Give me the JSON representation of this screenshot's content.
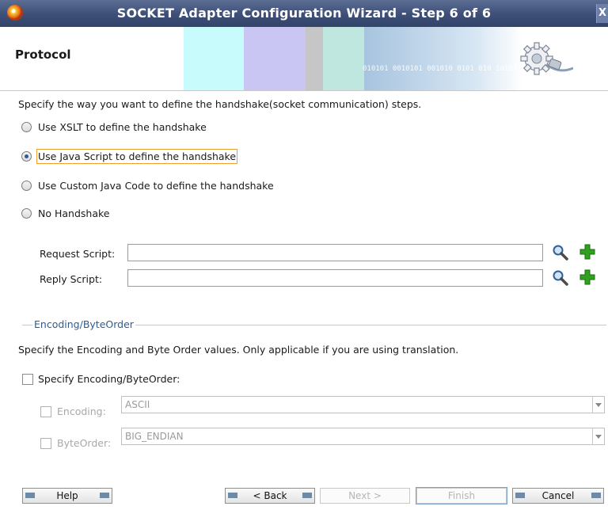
{
  "window": {
    "title": "SOCKET Adapter Configuration Wizard - Step 6 of 6",
    "close_glyph": "X"
  },
  "header": {
    "title": "Protocol",
    "banner_binary": "010101 0010101 001010 0101 010 10101"
  },
  "intro": "Specify the way you want to define the handshake(socket communication) steps.",
  "handshake_options": [
    {
      "label": "Use XSLT to define the handshake",
      "selected": false
    },
    {
      "label": "Use Java Script to define the handshake",
      "selected": true
    },
    {
      "label": "Use Custom Java Code to define the handshake",
      "selected": false
    },
    {
      "label": "No Handshake",
      "selected": false
    }
  ],
  "scripts": {
    "request_label": "Request Script:",
    "request_value": "",
    "reply_label": "Reply Script:",
    "reply_value": ""
  },
  "encoding_group": {
    "legend": "Encoding/ByteOrder",
    "description": "Specify the Encoding and Byte Order values. Only applicable if you are using translation.",
    "specify_label": "Specify Encoding/ByteOrder:",
    "specify_checked": false,
    "encoding_label": "Encoding:",
    "encoding_value": "ASCII",
    "byteorder_label": "ByteOrder:",
    "byteorder_value": "BIG_ENDIAN"
  },
  "buttons": {
    "help": "Help",
    "back": "< Back",
    "next": "Next >",
    "finish": "Finish",
    "cancel": "Cancel"
  },
  "icons": {
    "browse": "magnifier-icon",
    "add": "green-plus-icon",
    "app": "oracle-app-icon",
    "banner": "gear-plug-icon"
  },
  "colors": {
    "titlebar": "#3d4f77",
    "group_legend": "#2f5c8f",
    "focus": "#f0a030",
    "add_icon": "#2fa11e"
  }
}
